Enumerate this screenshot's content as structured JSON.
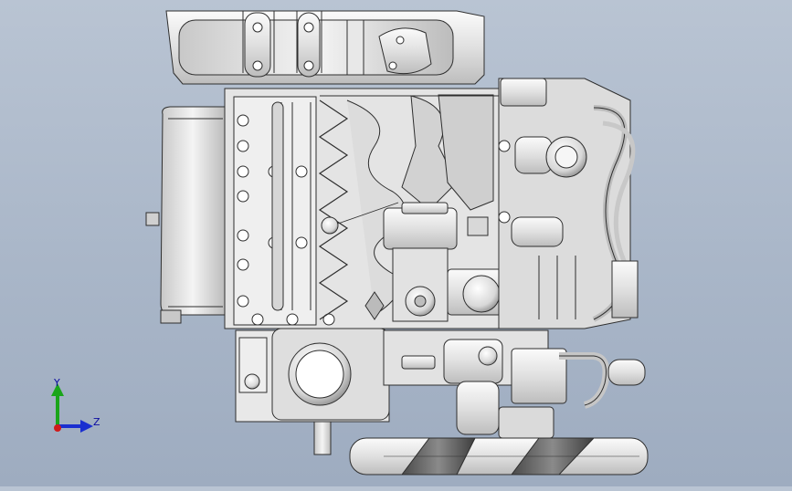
{
  "view": {
    "triad": {
      "y_label": "Y",
      "z_label": "Z",
      "y_color": "#1aa51a",
      "z_color": "#1a2fd0",
      "x_color": "#d01a1a"
    },
    "model_colors": {
      "edge": "#3a3a3a",
      "face_light": "#f2f2f2",
      "face_mid": "#d6d6d6",
      "face_dark": "#9a9a9a",
      "dark_band": "#5a5a5a"
    }
  }
}
